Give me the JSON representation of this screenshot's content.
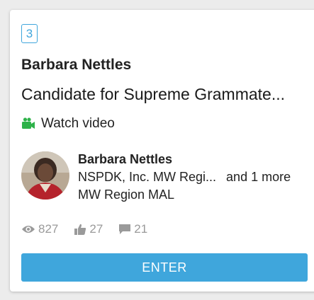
{
  "card": {
    "rank": "3",
    "name": "Barbara Nettles",
    "title": "Candidate for Supreme Grammate...",
    "watch_video_label": "Watch video",
    "watch_video_icon": "video-camera-icon",
    "profile": {
      "name": "Barbara Nettles",
      "affiliation_line1": "NSPDK, Inc. MW Regi...",
      "more": "and 1 more",
      "affiliation_line2": "MW Region MAL"
    },
    "stats": {
      "views": "827",
      "likes": "27",
      "comments": "21"
    },
    "enter_label": "ENTER"
  },
  "colors": {
    "accent": "#3fa6dc",
    "video_icon": "#2eb24a",
    "stat_gray": "#9a9a9a"
  }
}
